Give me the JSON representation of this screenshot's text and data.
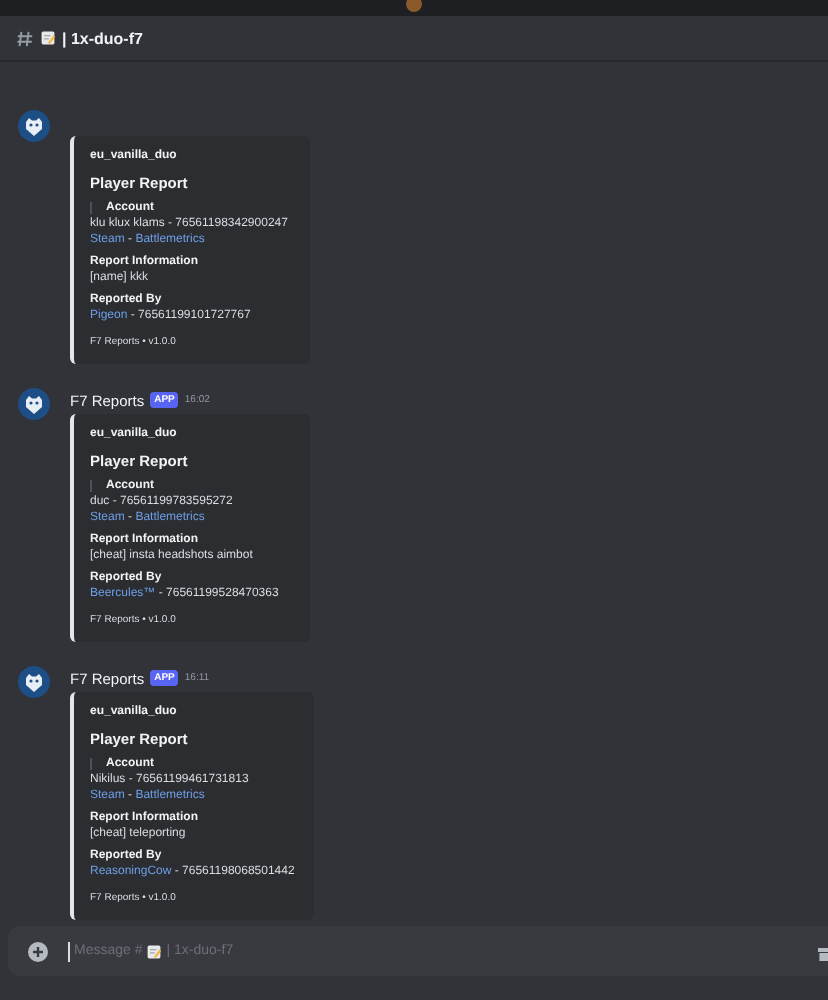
{
  "channel": {
    "name": "| 1x-duo-f7"
  },
  "messages": [
    {
      "embed": {
        "server": "eu_vanilla_duo",
        "title": "Player Report",
        "fields": [
          {
            "name": "Account",
            "quoted": true,
            "lines": [
              [
                {
                  "kind": "text",
                  "text": "klu klux klams - 76561198342900247"
                }
              ],
              [
                {
                  "kind": "link",
                  "text": "Steam"
                },
                {
                  "kind": "text",
                  "text": " - "
                },
                {
                  "kind": "link",
                  "text": "Battlemetrics"
                }
              ]
            ]
          },
          {
            "name": "Report Information",
            "quoted": false,
            "lines": [
              [
                {
                  "kind": "text",
                  "text": "[name] kkk"
                }
              ]
            ]
          },
          {
            "name": "Reported By",
            "quoted": false,
            "lines": [
              [
                {
                  "kind": "link",
                  "text": "Pigeon"
                },
                {
                  "kind": "text",
                  "text": " - 76561199101727767"
                }
              ]
            ]
          }
        ],
        "footer": "F7 Reports • v1.0.0"
      }
    },
    {
      "author": "F7 Reports",
      "badge": "APP",
      "time": "16:02",
      "embed": {
        "server": "eu_vanilla_duo",
        "title": "Player Report",
        "fields": [
          {
            "name": "Account",
            "quoted": true,
            "lines": [
              [
                {
                  "kind": "text",
                  "text": "duc - 76561199783595272"
                }
              ],
              [
                {
                  "kind": "link",
                  "text": "Steam"
                },
                {
                  "kind": "text",
                  "text": " - "
                },
                {
                  "kind": "link",
                  "text": "Battlemetrics"
                }
              ]
            ]
          },
          {
            "name": "Report Information",
            "quoted": false,
            "lines": [
              [
                {
                  "kind": "text",
                  "text": "[cheat] insta headshots aimbot"
                }
              ]
            ]
          },
          {
            "name": "Reported By",
            "quoted": false,
            "lines": [
              [
                {
                  "kind": "link",
                  "text": "Beercules™"
                },
                {
                  "kind": "text",
                  "text": " - 76561199528470363"
                }
              ]
            ]
          }
        ],
        "footer": "F7 Reports • v1.0.0"
      }
    },
    {
      "author": "F7 Reports",
      "badge": "APP",
      "time": "16:11",
      "embed": {
        "server": "eu_vanilla_duo",
        "title": "Player Report",
        "fields": [
          {
            "name": "Account",
            "quoted": true,
            "lines": [
              [
                {
                  "kind": "text",
                  "text": "Nikilus - 76561199461731813"
                }
              ],
              [
                {
                  "kind": "link",
                  "text": "Steam"
                },
                {
                  "kind": "text",
                  "text": " - "
                },
                {
                  "kind": "link",
                  "text": "Battlemetrics"
                }
              ]
            ]
          },
          {
            "name": "Report Information",
            "quoted": false,
            "lines": [
              [
                {
                  "kind": "text",
                  "text": "[cheat] teleporting"
                }
              ]
            ]
          },
          {
            "name": "Reported By",
            "quoted": false,
            "lines": [
              [
                {
                  "kind": "link",
                  "text": "ReasoningCow"
                },
                {
                  "kind": "text",
                  "text": " - 76561198068501442"
                }
              ]
            ]
          }
        ],
        "footer": "F7 Reports • v1.0.0"
      }
    }
  ],
  "composer": {
    "placeholder_prefix": "Message #",
    "placeholder_suffix": "| 1x-duo-f7"
  }
}
